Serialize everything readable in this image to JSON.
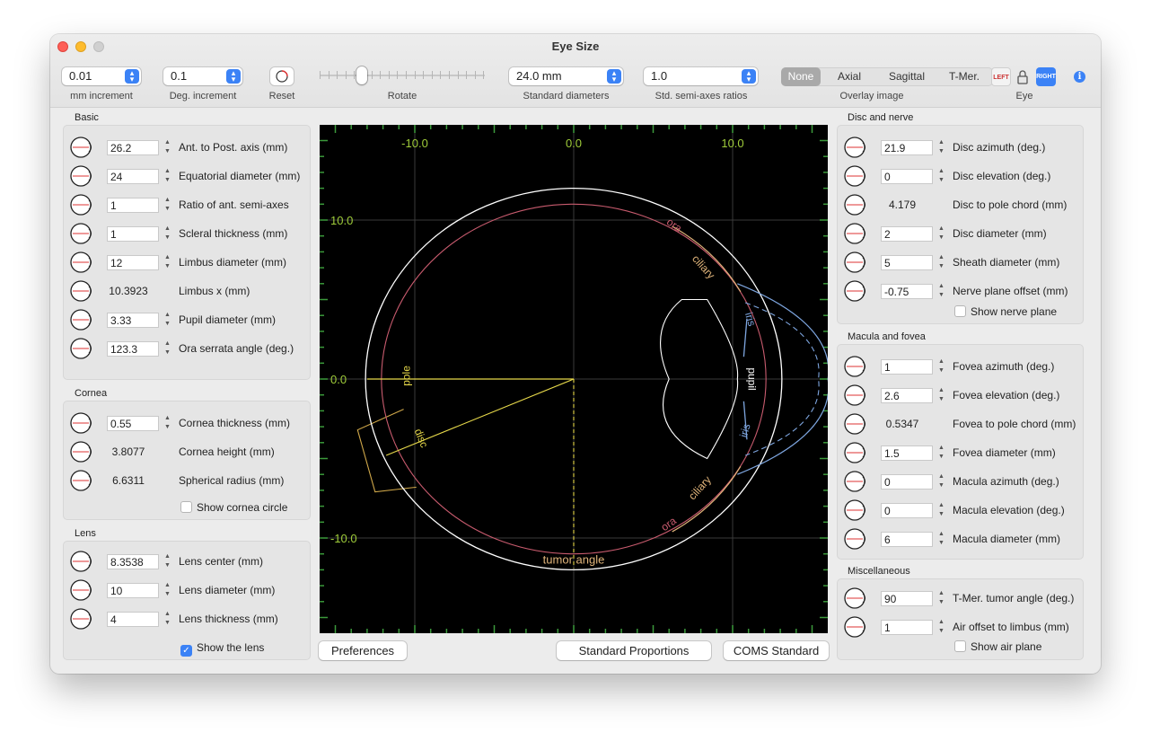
{
  "window": {
    "title": "Eye Size"
  },
  "toolbar": {
    "mm_increment": {
      "value": "0.01",
      "label": "mm increment"
    },
    "deg_increment": {
      "value": "0.1",
      "label": "Deg. increment"
    },
    "reset_label": "Reset",
    "rotate_label": "Rotate",
    "std_diameters": {
      "value": "24.0 mm",
      "label": "Standard diameters"
    },
    "std_ratios": {
      "value": "1.0",
      "label": "Std. semi-axes ratios"
    },
    "overlay": {
      "label": "Overlay image",
      "options": [
        "None",
        "Axial",
        "Sagittal",
        "T-Mer."
      ],
      "selected": "None"
    },
    "eye": {
      "label": "Eye",
      "left": "LEFT",
      "right": "RIGHT",
      "selected": "RIGHT"
    }
  },
  "basic": {
    "title": "Basic",
    "rows": [
      {
        "value": "26.2",
        "label": "Ant. to Post. axis (mm)",
        "icon": "ap-axis-icon"
      },
      {
        "value": "24",
        "label": "Equatorial diameter (mm)",
        "icon": "equatorial-icon"
      },
      {
        "value": "1",
        "label": "Ratio of ant. semi-axes",
        "icon": "ratio-icon"
      },
      {
        "value": "1",
        "label": "Scleral thickness (mm)",
        "icon": "sclera-icon"
      },
      {
        "value": "12",
        "label": "Limbus diameter (mm)",
        "icon": "limbus-icon"
      },
      {
        "value": "10.3923",
        "label": "Limbus x (mm)",
        "icon": "limbus-x-icon",
        "static": true
      },
      {
        "value": "3.33",
        "label": "Pupil diameter (mm)",
        "icon": "pupil-icon"
      },
      {
        "value": "123.3",
        "label": "Ora serrata angle (deg.)",
        "icon": "ora-icon"
      }
    ]
  },
  "cornea": {
    "title": "Cornea",
    "rows": [
      {
        "value": "0.55",
        "label": "Cornea thickness (mm)",
        "icon": "cornea-thickness-icon"
      },
      {
        "value": "3.8077",
        "label": "Cornea height (mm)",
        "icon": "cornea-height-icon",
        "static": true
      },
      {
        "value": "6.6311",
        "label": "Spherical radius (mm)",
        "icon": "spherical-radius-icon",
        "static": true
      }
    ],
    "checkbox": {
      "label": "Show cornea circle",
      "checked": false
    }
  },
  "lens": {
    "title": "Lens",
    "rows": [
      {
        "value": "8.3538",
        "label": "Lens center (mm)",
        "icon": "lens-center-icon"
      },
      {
        "value": "10",
        "label": "Lens diameter (mm)",
        "icon": "lens-diameter-icon"
      },
      {
        "value": "4",
        "label": "Lens thickness (mm)",
        "icon": "lens-thickness-icon"
      }
    ],
    "checkbox": {
      "label": "Show the lens",
      "checked": true
    }
  },
  "disc": {
    "title": "Disc and nerve",
    "rows": [
      {
        "value": "21.9",
        "label": "Disc azimuth (deg.)",
        "icon": "disc-azimuth-icon"
      },
      {
        "value": "0",
        "label": "Disc elevation (deg.)",
        "icon": "disc-elevation-icon"
      },
      {
        "value": "4.179",
        "label": "Disc to pole chord (mm)",
        "icon": "disc-chord-icon",
        "static": true
      },
      {
        "value": "2",
        "label": "Disc diameter (mm)",
        "icon": "disc-diameter-icon"
      },
      {
        "value": "5",
        "label": "Sheath diameter (mm)",
        "icon": "sheath-icon"
      },
      {
        "value": "-0.75",
        "label": "Nerve plane offset (mm)",
        "icon": "nerve-plane-icon"
      }
    ],
    "checkbox": {
      "label": "Show nerve plane",
      "checked": false
    }
  },
  "macula": {
    "title": "Macula and fovea",
    "rows": [
      {
        "value": "1",
        "label": "Fovea azimuth (deg.)",
        "icon": "fovea-azimuth-icon"
      },
      {
        "value": "2.6",
        "label": "Fovea elevation (deg.)",
        "icon": "fovea-elevation-icon"
      },
      {
        "value": "0.5347",
        "label": "Fovea to pole chord (mm)",
        "icon": "fovea-chord-icon",
        "static": true
      },
      {
        "value": "1.5",
        "label": "Fovea diameter (mm)",
        "icon": "fovea-diameter-icon"
      },
      {
        "value": "0",
        "label": "Macula azimuth (deg.)",
        "icon": "macula-azimuth-icon"
      },
      {
        "value": "0",
        "label": "Macula elevation (deg.)",
        "icon": "macula-elevation-icon"
      },
      {
        "value": "6",
        "label": "Macula diameter (mm)",
        "icon": "macula-diameter-icon"
      }
    ]
  },
  "misc": {
    "title": "Miscellaneous",
    "rows": [
      {
        "value": "90",
        "label": "T-Mer. tumor angle (deg.)",
        "icon": "tumor-angle-icon"
      },
      {
        "value": "1",
        "label": "Air offset to limbus (mm)",
        "icon": "air-offset-icon"
      }
    ],
    "checkbox": {
      "label": "Show air plane",
      "checked": false
    }
  },
  "canvas": {
    "x_ticks": [
      "-10.0",
      "0.0",
      "10.0"
    ],
    "y_ticks": [
      "10.0",
      "0.0",
      "-10.0"
    ],
    "labels": {
      "ora": "ora",
      "ciliary": "ciliary",
      "iris": "iris",
      "pupil": "pupil",
      "pole": "pole",
      "disc": "disc",
      "tumor_angle": "tumor angle"
    },
    "colors": {
      "background": "#000000",
      "grid": "#3a3a3a",
      "ticks": "#3c9a3c",
      "tick_labels": "#9fcc3a",
      "sclera": "#ffffff",
      "retina": "#c85b6e",
      "iris": "#7ea6e0",
      "yellow": "#e6d84a",
      "ciliary": "#e0b47a",
      "nerve": "#d0a84a"
    }
  },
  "buttons": {
    "preferences": "Preferences",
    "standard_proportions": "Standard Proportions",
    "coms_standard": "COMS Standard"
  }
}
